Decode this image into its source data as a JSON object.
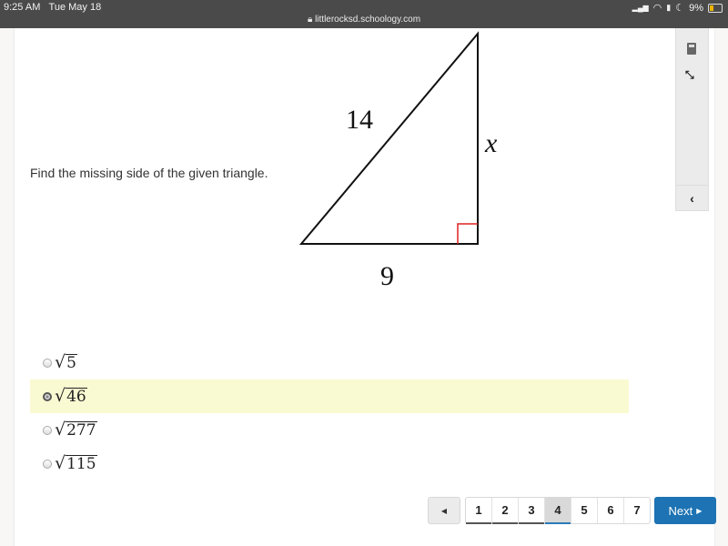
{
  "status_bar": {
    "time": "9:25 AM",
    "date": "Tue May 18",
    "url": "littlerocksd.schoology.com",
    "battery": "9%"
  },
  "tools": {
    "calculator_icon": "calculator-icon",
    "expand_icon": "expand-icon",
    "collapse_glyph": "‹"
  },
  "question": {
    "prompt": "Find the missing side of the given triangle.",
    "figure": {
      "hypotenuse_label": "14",
      "vertical_label": "x",
      "base_label": "9",
      "right_angle_color": "#e02020"
    }
  },
  "choices": [
    {
      "radicand": "5",
      "selected": false
    },
    {
      "radicand": "46",
      "selected": true
    },
    {
      "radicand": "277",
      "selected": false
    },
    {
      "radicand": "115",
      "selected": false
    }
  ],
  "pager": {
    "prev_glyph": "◀",
    "pages": [
      "1",
      "2",
      "3",
      "4",
      "5",
      "6",
      "7"
    ],
    "current_page": "4",
    "next_label": "Next",
    "next_glyph": "▶",
    "accent": "#1d73b3"
  }
}
